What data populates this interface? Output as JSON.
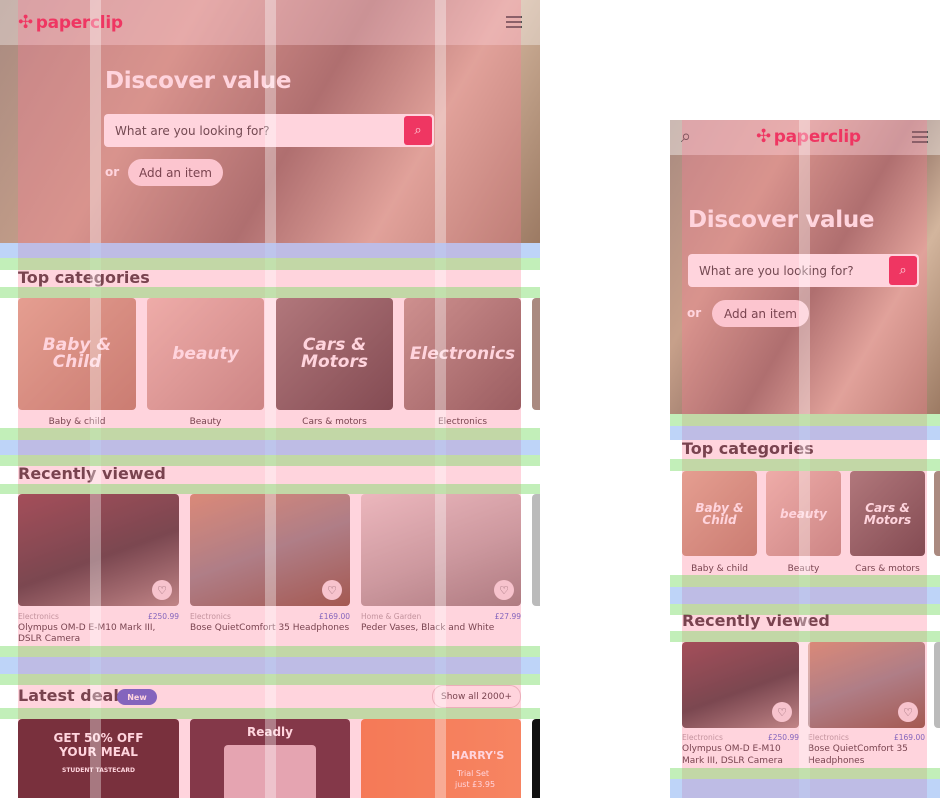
{
  "brand": {
    "name": "paperclip",
    "color": "#e8174a"
  },
  "hero": {
    "title": "Discover value",
    "search_placeholder": "What are you looking for?",
    "or": "or",
    "add_item": "Add an item"
  },
  "categories": {
    "title": "Top categories",
    "items": [
      {
        "label": "Baby & child",
        "art": "Baby & Child"
      },
      {
        "label": "Beauty",
        "art": "beauty"
      },
      {
        "label": "Cars & motors",
        "art": "Cars & Motors"
      },
      {
        "label": "Electronics",
        "art": "Electronics"
      }
    ]
  },
  "recent": {
    "title": "Recently viewed",
    "items": [
      {
        "category": "Electronics",
        "price": "£250.99",
        "name": "Olympus OM-D E-M10 Mark III, DSLR Camera"
      },
      {
        "category": "Electronics",
        "price": "£169.00",
        "name": "Bose QuietComfort 35 Headphones"
      },
      {
        "category": "Home & Garden",
        "price": "£27.99",
        "name": "Peder Vases, Black and White"
      }
    ]
  },
  "deals": {
    "title": "Latest deals",
    "badge": "New",
    "show_all": "Show all 2000+",
    "items": [
      {
        "line1": "GET 50% OFF",
        "line2": "YOUR MEAL",
        "line3": "STUDENT TASTECARD"
      },
      {
        "line1": "Readly"
      },
      {
        "line1": "HARRY'S",
        "line2": "Trial Set",
        "line3": "just £3.95"
      }
    ]
  },
  "colors": {
    "accent": "#e8174a",
    "price": "#4a5bd0"
  }
}
